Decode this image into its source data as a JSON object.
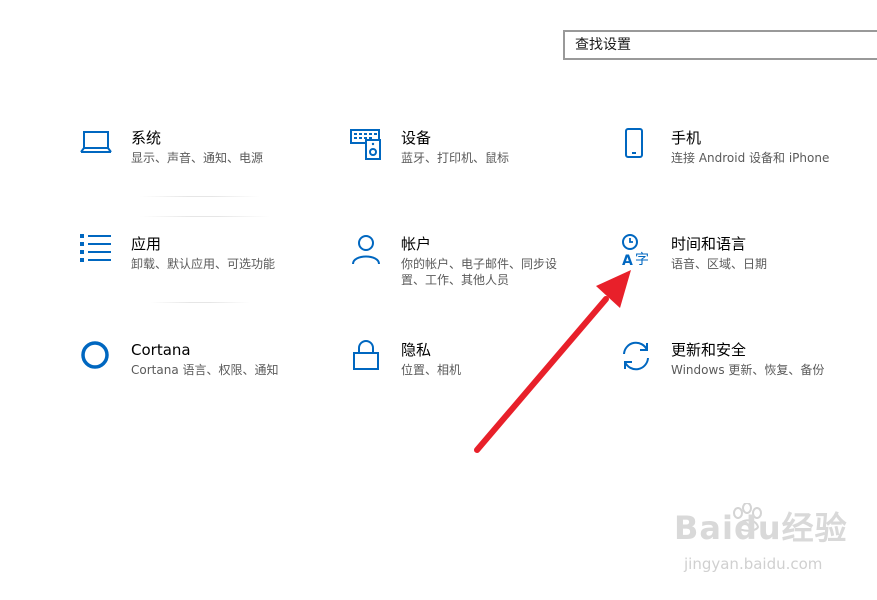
{
  "search": {
    "placeholder": "查找设置"
  },
  "tiles": [
    {
      "title": "系统",
      "desc": "显示、声音、通知、电源",
      "icon": "laptop-icon"
    },
    {
      "title": "设备",
      "desc": "蓝牙、打印机、鼠标",
      "icon": "keyboard-speaker-icon"
    },
    {
      "title": "手机",
      "desc": "连接 Android 设备和 iPhone",
      "icon": "phone-icon"
    },
    {
      "title": "应用",
      "desc": "卸载、默认应用、可选功能",
      "icon": "apps-list-icon"
    },
    {
      "title": "帐户",
      "desc": "你的帐户、电子邮件、同步设置、工作、其他人员",
      "icon": "person-icon"
    },
    {
      "title": "时间和语言",
      "desc": "语音、区域、日期",
      "icon": "time-language-icon"
    },
    {
      "title": "Cortana",
      "desc": "Cortana 语言、权限、通知",
      "icon": "cortana-icon"
    },
    {
      "title": "隐私",
      "desc": "位置、相机",
      "icon": "lock-icon"
    },
    {
      "title": "更新和安全",
      "desc": "Windows 更新、恢复、备份",
      "icon": "sync-icon"
    }
  ],
  "watermark": {
    "logo_text": "Baidu经验",
    "url": "jingyan.baidu.com"
  },
  "colors": {
    "accent": "#0067c0",
    "arrow": "#e8202a",
    "text": "#000000",
    "secondary_text": "#5a5a5a"
  }
}
